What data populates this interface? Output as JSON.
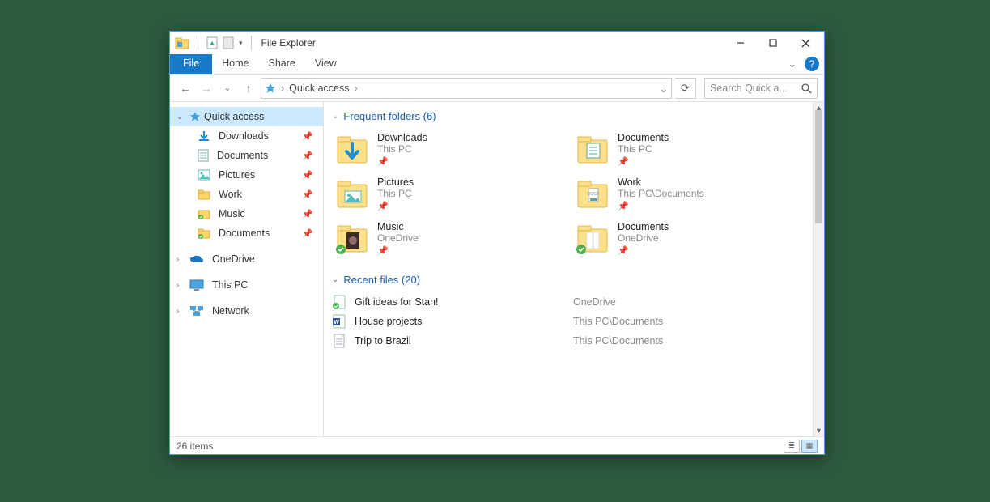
{
  "window": {
    "title": "File Explorer"
  },
  "ribbon": {
    "file": "File",
    "tabs": [
      "Home",
      "Share",
      "View"
    ]
  },
  "address": {
    "location": "Quick access",
    "crumb_sep": "›"
  },
  "search": {
    "placeholder": "Search Quick a..."
  },
  "navpane": {
    "quick_access": {
      "label": "Quick access"
    },
    "items": [
      {
        "label": "Downloads",
        "icon": "download",
        "pinned": true
      },
      {
        "label": "Documents",
        "icon": "document",
        "pinned": true
      },
      {
        "label": "Pictures",
        "icon": "pictures",
        "pinned": true
      },
      {
        "label": "Work",
        "icon": "folder",
        "pinned": true
      },
      {
        "label": "Music",
        "icon": "music",
        "pinned": true
      },
      {
        "label": "Documents",
        "icon": "folder-green",
        "pinned": true
      }
    ],
    "roots": [
      {
        "label": "OneDrive",
        "icon": "onedrive"
      },
      {
        "label": "This PC",
        "icon": "thispc"
      },
      {
        "label": "Network",
        "icon": "network"
      }
    ]
  },
  "sections": {
    "frequent": {
      "title": "Frequent folders (6)"
    },
    "recent": {
      "title": "Recent files (20)"
    }
  },
  "frequent_folders": [
    {
      "name": "Downloads",
      "sub": "This PC",
      "icon": "folder-download"
    },
    {
      "name": "Documents",
      "sub": "This PC",
      "icon": "folder-docs"
    },
    {
      "name": "Pictures",
      "sub": "This PC",
      "icon": "folder-pictures"
    },
    {
      "name": "Work",
      "sub": "This PC\\Documents",
      "icon": "folder-docx"
    },
    {
      "name": "Music",
      "sub": "OneDrive",
      "icon": "folder-music",
      "synced": true
    },
    {
      "name": "Documents",
      "sub": "OneDrive",
      "icon": "folder-plain",
      "synced": true
    }
  ],
  "recent_files": [
    {
      "name": "Gift ideas for Stan!",
      "location": "OneDrive",
      "icon": "file-synced"
    },
    {
      "name": "House projects",
      "location": "This PC\\Documents",
      "icon": "file-word"
    },
    {
      "name": "Trip to Brazil",
      "location": "This PC\\Documents",
      "icon": "file-generic"
    }
  ],
  "status": {
    "items_text": "26 items"
  },
  "colors": {
    "accent": "#1979ca",
    "selection": "#cce8ff",
    "link": "#1a5fb4"
  }
}
